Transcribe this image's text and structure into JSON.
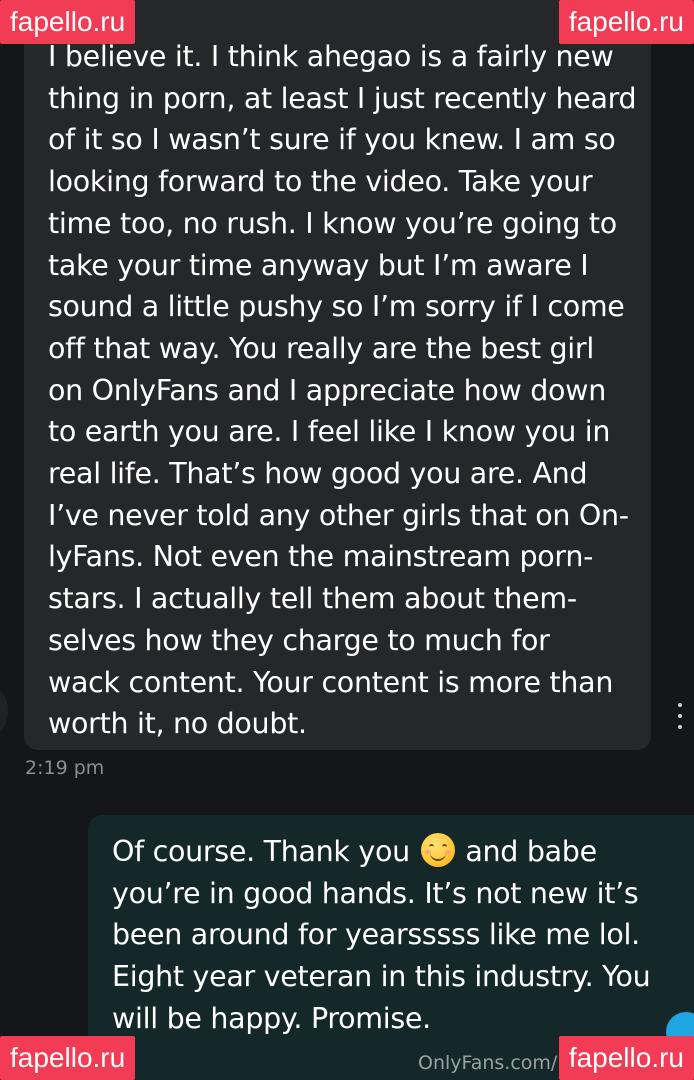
{
  "incoming_message": {
    "text": "I believe it. I think ahegao is a fairly new\nthing in porn, at least I just recently heard\nof it so I wasn’t sure if you knew. I am so\nlooking forward to the video. Take your\ntime too, no rush. I know you’re going to\ntake your time anyway but I’m aware I\nsound a little pushy so I’m sorry if I come\noff that way. You really are the best girl\non OnlyFans and I appreciate how down\nto earth you are. I feel like I know you in\nreal life. That’s how good you are. And\nI’ve never told any other girls that on On-\nlyFans. Not even the mainstream porn-\nstars. I actually tell them about them-\nselves how they charge to much for\nwack content. Your content is more than\nworth it, no doubt.",
    "time": "2:19 pm"
  },
  "outgoing_message": {
    "text_before_emoji": "Of course. Thank you ",
    "emoji_icon": "smiling-face-emoji",
    "text_after_emoji": " and babe\nyou’re in good hands. It’s not new it’s\nbeen around for yearsssss like me lol.\nEight year veteran in this industry. You\nwill be happy. Promise."
  },
  "footer": {
    "url": "OnlyFans.com/"
  },
  "watermarks": {
    "top_left": "fapello.ru",
    "top_right": "fapello.ru",
    "bottom_left": "fapello.ru",
    "bottom_right": "fapello.ru"
  },
  "colors": {
    "background": "#151617",
    "incoming_bubble": "#262729",
    "outgoing_bubble": "#14282a",
    "watermark": "#f23b55",
    "accent_blue": "#1fa7e3"
  }
}
